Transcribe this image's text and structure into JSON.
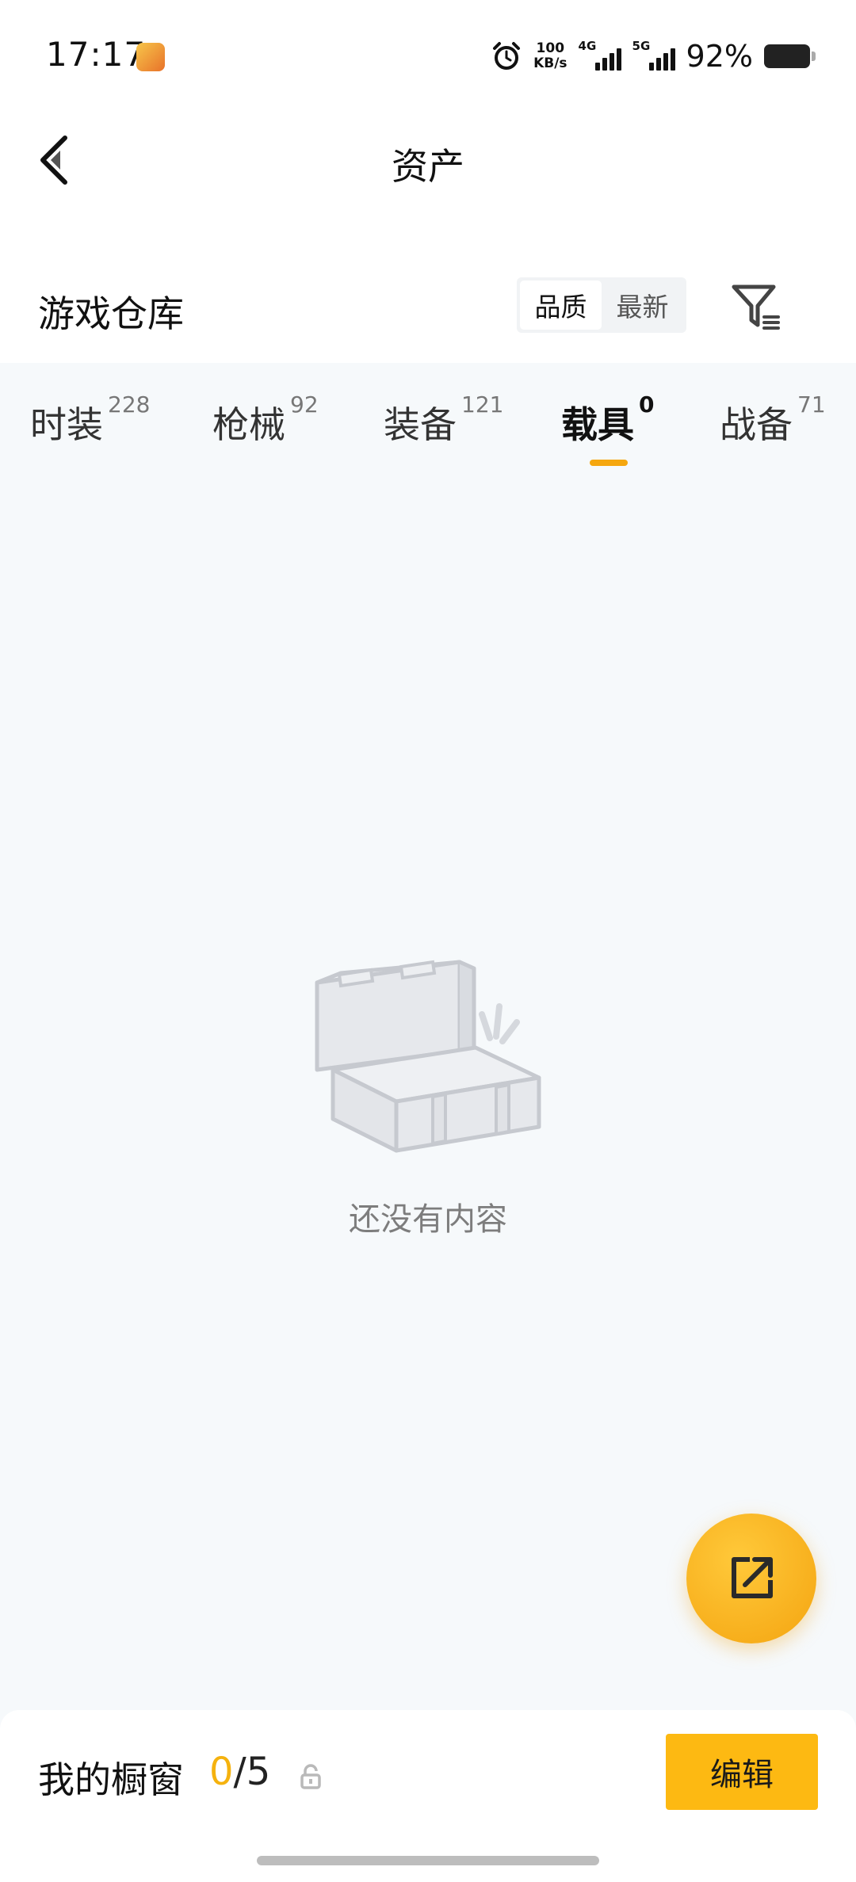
{
  "status_bar": {
    "time": "17:17",
    "net_speed_value": "100",
    "net_speed_unit": "KB/s",
    "sig1_label": "4G",
    "sig2_label": "5G",
    "battery_percent": "92%"
  },
  "header": {
    "title": "资产"
  },
  "section": {
    "title": "游戏仓库",
    "sort_options": [
      "品质",
      "最新"
    ],
    "sort_selected": "品质"
  },
  "tabs": [
    {
      "label": "时装",
      "count": "228"
    },
    {
      "label": "枪械",
      "count": "92"
    },
    {
      "label": "装备",
      "count": "121"
    },
    {
      "label": "载具",
      "count": "0"
    },
    {
      "label": "战备",
      "count": "71"
    }
  ],
  "active_tab": "载具",
  "empty_state": {
    "text": "还没有内容"
  },
  "bottom_bar": {
    "showcase_label": "我的橱窗",
    "showcase_current": "0",
    "showcase_separator": "/",
    "showcase_total": "5",
    "edit_label": "编辑"
  },
  "colors": {
    "accent": "#fdb912",
    "tab_underline": "#f5a70f",
    "background": "#f6f9fb"
  },
  "icons": {
    "back": "chevron-left-icon",
    "filter": "filter-icon",
    "share": "share-external-icon",
    "lock": "lock-icon",
    "alarm": "alarm-icon",
    "empty": "empty-box-icon"
  }
}
